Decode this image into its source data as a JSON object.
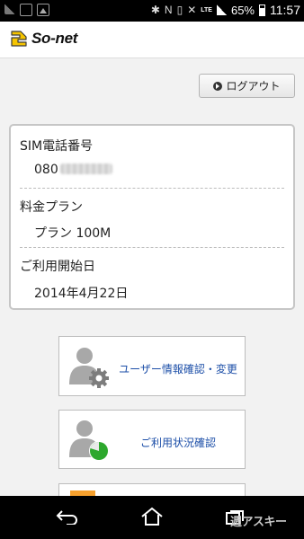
{
  "status_bar": {
    "battery_percent": "65%",
    "network_type": "LTE",
    "time": "11:57"
  },
  "header": {
    "logo_text": "So-net"
  },
  "logout_button": {
    "label": "ログアウト"
  },
  "account_info": {
    "phone_label": "SIM電話番号",
    "phone_prefix": "080",
    "plan_label": "料金プラン",
    "plan_value": "プラン 100M",
    "start_date_label": "ご利用開始日",
    "start_date_value": "2014年4月22日"
  },
  "menu": [
    {
      "label": "ユーザー情報確認・変更",
      "icon": "user-gear-icon"
    },
    {
      "label": "ご利用状況確認",
      "icon": "user-usage-chart-icon"
    },
    {
      "label": "",
      "icon": "orange-menu-icon"
    }
  ],
  "navbar": {
    "watermark": "週アスキー"
  },
  "colors": {
    "link_blue": "#1d4fa8",
    "logo_yellow": "#f5c400",
    "usage_green": "#2da82d",
    "icon_gray": "#a8a8a8",
    "accent_orange": "#f7a12e"
  }
}
